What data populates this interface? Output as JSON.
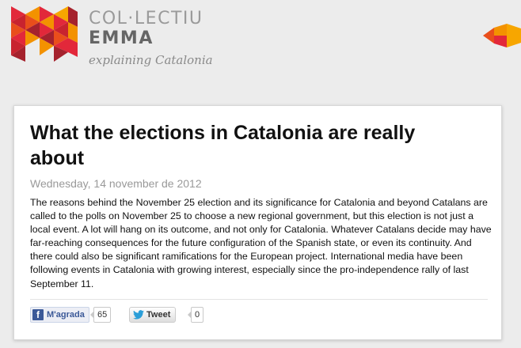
{
  "brand": {
    "line1": "COL·LECTIU",
    "line2": "EMMA",
    "tagline": "explaining Catalonia",
    "logo_icon": "emma-logo-icon",
    "colors": {
      "red": "#e2283a",
      "orange": "#f39200",
      "dark_red": "#a5222d"
    }
  },
  "article": {
    "title": "What the elections in Catalonia are really about",
    "date": "Wednesday, 14 november de 2012",
    "body": "The reasons behind the November 25 election and its significance for Catalonia and beyond Catalans are called to the polls on November 25 to choose a new regional government, but this election is not just a local event. A lot will hang on its outcome, and not only for Catalonia. Whatever Catalans decide may have far-reaching consequences for the future configuration of the Spanish state, or even its continuity. And there could also be significant ramifications for the European project.   International media have been following events in Catalonia with growing interest, especially since the pro-independence rally of last September 11."
  },
  "social": {
    "facebook_label": "M'agrada",
    "facebook_count": "65",
    "twitter_label": "Tweet",
    "twitter_count": "0"
  }
}
